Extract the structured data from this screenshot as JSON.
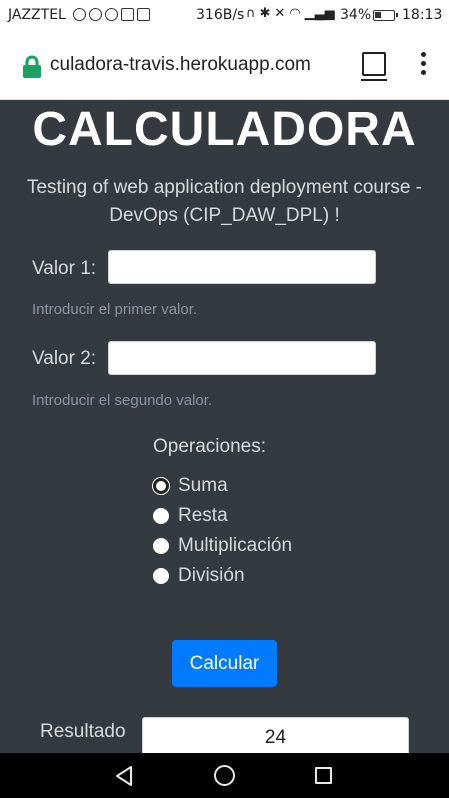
{
  "status_bar": {
    "carrier": "JAZZTEL",
    "speed": "316B/s",
    "battery_pct": "34%",
    "time": "18:13"
  },
  "browser": {
    "url": "culadora-travis.herokuapp.com"
  },
  "page": {
    "title": "CALCULADORA",
    "subtitle": "Testing of web application deployment course - DevOps (CIP_DAW_DPL) !",
    "valor1": {
      "label": "Valor 1:",
      "value": "",
      "help": "Introducir el primer valor."
    },
    "valor2": {
      "label": "Valor 2:",
      "value": "",
      "help": "Introducir el segundo valor."
    },
    "operations_label": "Operaciones:",
    "operations": [
      {
        "label": "Suma",
        "focused": true
      },
      {
        "label": "Resta",
        "focused": false
      },
      {
        "label": "Multiplicación",
        "focused": false
      },
      {
        "label": "División",
        "focused": false
      }
    ],
    "calc_button": "Calcular",
    "result_label": "Resultado",
    "result_value": "24"
  },
  "colors": {
    "background": "#343a40",
    "primary": "#007bff",
    "lock": "#1aa260"
  }
}
